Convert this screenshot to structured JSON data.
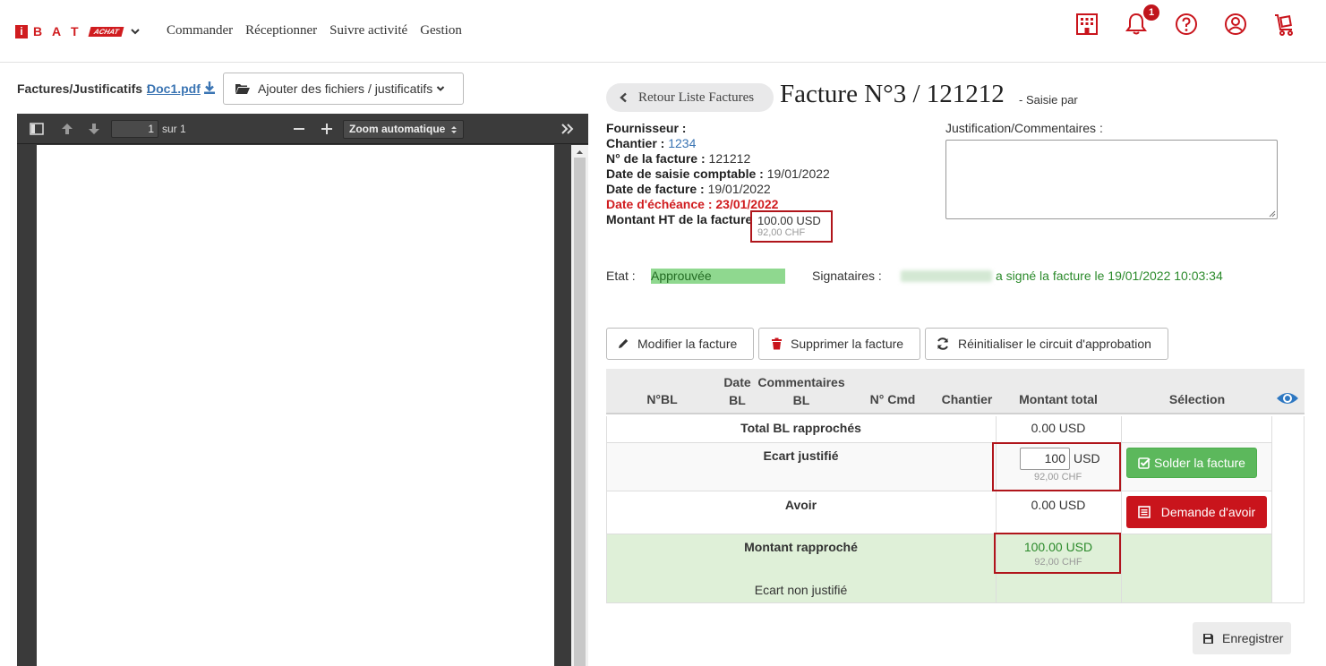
{
  "nav": {
    "logo_letters": [
      "i",
      "B",
      "A",
      "T"
    ],
    "logo_badge": "ACHAT",
    "items": [
      "Commander",
      "Réceptionner",
      "Suivre activité",
      "Gestion"
    ],
    "notification_count": "1"
  },
  "documents": {
    "label": "Factures/Justificatifs",
    "separator": " : ",
    "file_name": "Doc1.pdf",
    "add_button": "Ajouter des fichiers / justificatifs"
  },
  "viewer": {
    "page_number": "1",
    "page_of": "sur 1",
    "zoom": "Zoom automatique"
  },
  "invoice": {
    "back_button": "Retour Liste Factures",
    "title": "Facture N°3 / 121212",
    "subtitle": "- Saisie par",
    "fournisseur_label": "Fournisseur :",
    "chantier_label": "Chantier :",
    "chantier_value": "1234",
    "numero_label": "N° de la facture :",
    "numero_value": "121212",
    "saisie_label": "Date de saisie comptable :",
    "saisie_value": "19/01/2022",
    "date_label": "Date de facture :",
    "date_value": "19/01/2022",
    "echeance_text": "Date d'échéance : 23/01/2022",
    "montant_label": "Montant HT de la facture",
    "montant_value": "100.00 USD",
    "montant_chf": "92,00 CHF",
    "comment_label": "Justification/Commentaires :",
    "etat_label": "Etat :",
    "etat_value": "Approuvée",
    "signataires_label": "Signataires :",
    "signataires_text": "a signé la facture le 19/01/2022 10:03:34"
  },
  "actions": {
    "modify": "Modifier la facture",
    "delete": "Supprimer la facture",
    "reset": "Réinitialiser le circuit d'approbation"
  },
  "table": {
    "headers": {
      "nbl": "N°BL",
      "date_bl_1": "Date",
      "date_bl_2": "BL",
      "comm_bl_1": "Commentaires",
      "comm_bl_2": "BL",
      "ncmd": "N° Cmd",
      "chantier": "Chantier",
      "montant": "Montant total",
      "selection": "Sélection"
    },
    "total_bl_label": "Total BL rapprochés",
    "total_bl_value": "0.00 USD",
    "ecart_label": "Ecart justifié",
    "ecart_input": "100",
    "ecart_currency": "USD",
    "ecart_chf": "92,00 CHF",
    "solder_button": "Solder la facture",
    "avoir_label": "Avoir",
    "avoir_value": "0.00 USD",
    "avoir_button": "Demande d'avoir",
    "rapproche_label": "Montant rapproché",
    "rapproche_value": "100.00 USD",
    "rapproche_chf": "92,00 CHF",
    "non_justifie_label": "Ecart non justifié"
  },
  "save_button": "Enregistrer",
  "colors": {
    "brand_red": "#d01c1f",
    "approved_green": "#8fd88f",
    "success_green": "#5cb85c",
    "highlight_row": "#dff0d8"
  }
}
